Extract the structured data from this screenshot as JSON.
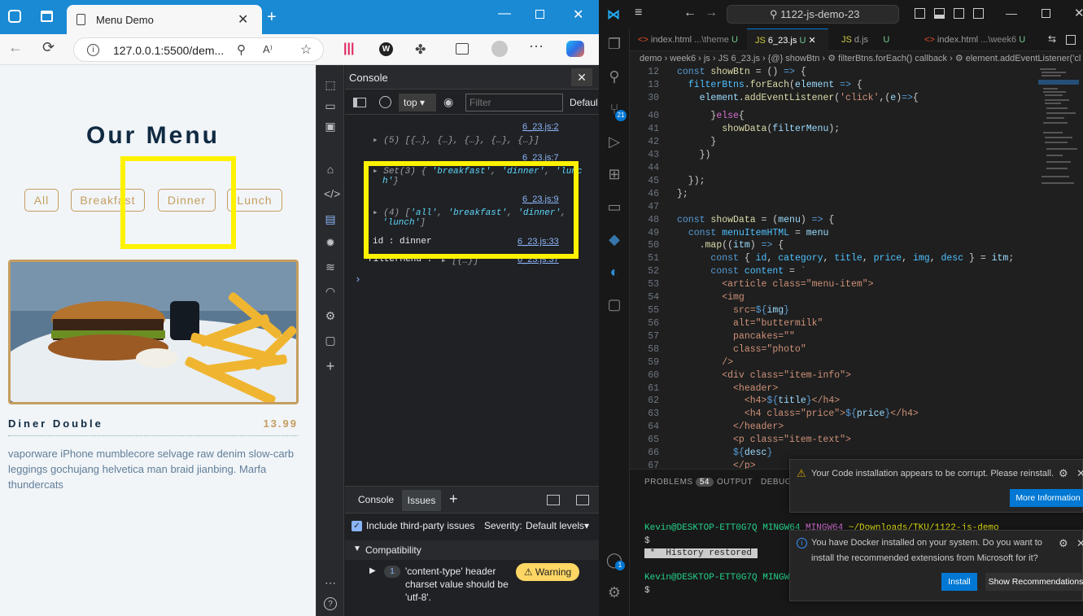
{
  "browser": {
    "tab_title": "Menu Demo",
    "url": "127.0.0.1:5500/dem..."
  },
  "page": {
    "title": "Our Menu",
    "filters": [
      "All",
      "Breakfast",
      "Dinner",
      "Lunch"
    ],
    "item": {
      "name": "Diner Double",
      "price": "13.99",
      "desc": "vaporware iPhone mumblecore selvage raw denim slow-carb leggings gochujang helvetica man braid jianbing. Marfa thundercats"
    }
  },
  "devtools": {
    "panel_title": "Console",
    "context": "top",
    "filter_placeholder": "Filter",
    "levels": "Defaul",
    "logs": [
      {
        "source": "6_23.js:2",
        "text": "(5) [{…}, {…}, {…}, {…}, {…}]"
      },
      {
        "source": "6_23.js:7",
        "text1": "Set(3) {",
        "s1": "'breakfast'",
        "s2": "'dinner'",
        "s3": "'lunc",
        "s4": "h'",
        "text2": "}"
      },
      {
        "source": "6_23.js:9",
        "text1": "(4) [",
        "s1": "'all'",
        "s2": "'breakfast'",
        "s3": "'dinner'",
        "s4": "'lunch'",
        "text2": "]"
      },
      {
        "source": "6_23.js:33",
        "text": "id : dinner"
      },
      {
        "source": "6_23.js:37",
        "label": "filterMenu :",
        "text": "[{…}]"
      }
    ],
    "bottom_tabs": {
      "console": "Console",
      "issues": "Issues"
    },
    "include_third_party": "Include third-party issues",
    "severity_label": "Severity:",
    "severity_value": "Default levels",
    "compat_label": "Compatibility",
    "issue_count": "1",
    "issue_text": [
      "'content-type' header",
      "charset value should be",
      "'utf-8'."
    ],
    "warning_label": "Warning"
  },
  "vscode": {
    "search_text": "1122-js-demo-23",
    "tabs": [
      {
        "name": "index.html",
        "hint": "...\\theme",
        "status": "U"
      },
      {
        "name": "6_23.js",
        "hint": "",
        "status": "U"
      },
      {
        "name": "d.js",
        "hint": "",
        "status": "U"
      },
      {
        "name": "index.html",
        "hint": "...\\week6",
        "status": "U"
      }
    ],
    "breadcrumb": "demo  ›  week6  ›  js  ›  JS 6_23.js  ›  {@} showBtn  ›  ⚙ filterBtns.forEach() callback  ›  ⚙ element.addEventListener('cl",
    "scm_badge": "21",
    "account_badge": "1",
    "panel": {
      "problems": "PROBLEMS",
      "problems_count": "54",
      "output": "OUTPUT",
      "debug": "DEBUG C"
    },
    "terminal": {
      "prompt1": "Kevin@DESKTOP-ETT0G7Q MINGW64",
      "path1": " ~/Downloads/TKU/1122-js-demo",
      "dollar": "$",
      "history": " *  History restored ",
      "prompt2": "Kevin@DESKTOP-ETT0G7Q MINGW64"
    },
    "notif1": {
      "text": "Your Code installation appears to be corrupt. Please reinstall.",
      "button": "More Information"
    },
    "notif2": {
      "text_line1": "You have Docker installed on your system. Do you want to",
      "text_line2": "install the recommended extensions from Microsoft for it?",
      "install": "Install",
      "show": "Show Recommendations"
    }
  },
  "colors": {
    "accent_gold": "#c59d5f",
    "highlight_yellow": "#fff200",
    "edge_blue": "#1a8ad4",
    "vscode_blue": "#0078d4"
  }
}
